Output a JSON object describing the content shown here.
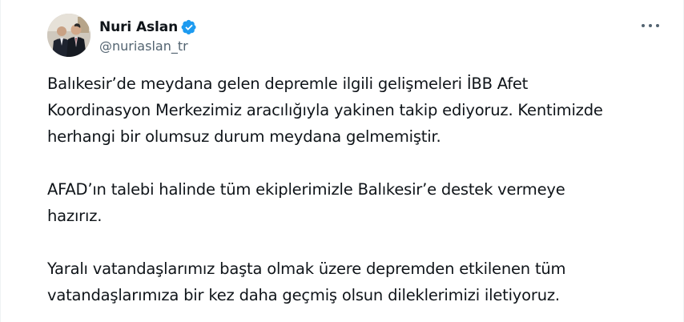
{
  "author": {
    "display_name": "Nuri Aslan",
    "handle": "@nuriaslan_tr",
    "verified": true,
    "verified_color": "#1d9bf0"
  },
  "actions": {
    "more_icon": "more-horizontal-icon"
  },
  "tweet": {
    "paragraphs": [
      {
        "lines": [
          "Balıkesir’de meydana gelen depremle ilgili gelişmeleri İBB Afet",
          "Koordinasyon Merkezimiz aracılığıyla yakinen takip ediyoruz. Kentimizde",
          "herhangi bir olumsuz durum meydana gelmemiştir."
        ]
      },
      {
        "lines": [
          "AFAD’ın talebi halinde tüm ekiplerimizle Balıkesir’e destek vermeye",
          "hazırız."
        ]
      },
      {
        "lines": [
          "Yaralı vatandaşlarımız başta olmak üzere depremden etkilenen tüm",
          "vatandaşlarımıza bir kez daha geçmiş olsun dileklerimizi iletiyoruz."
        ]
      }
    ]
  }
}
